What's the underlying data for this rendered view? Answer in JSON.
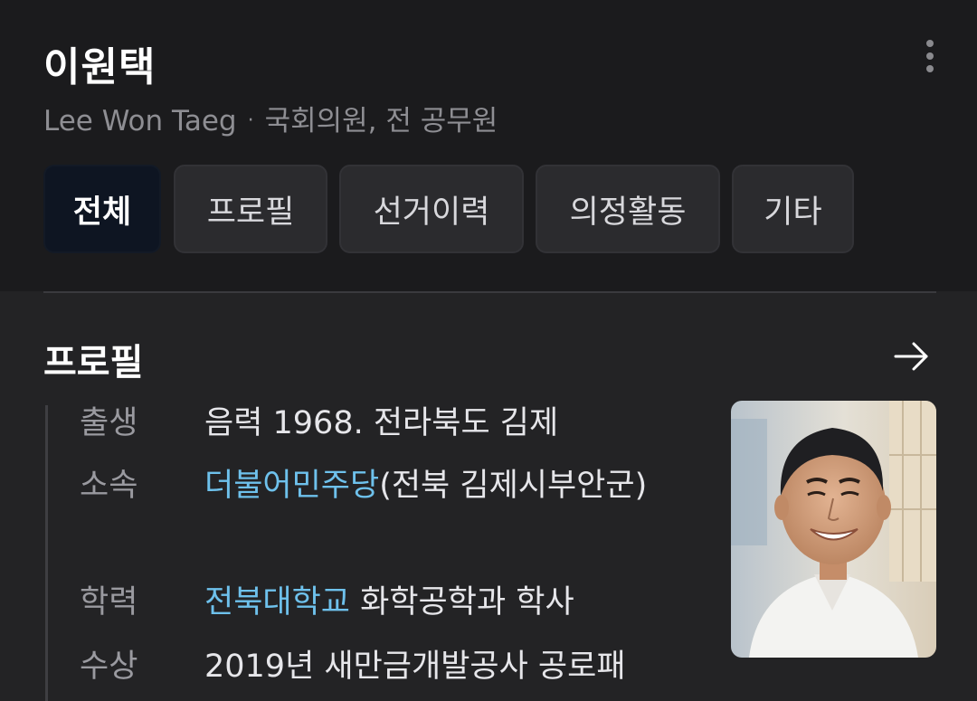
{
  "header": {
    "name": "이원택",
    "english_name": "Lee Won Taeg",
    "separator": "·",
    "occupation": "국회의원, 전 공무원"
  },
  "tabs": [
    {
      "label": "전체",
      "active": true
    },
    {
      "label": "프로필",
      "active": false
    },
    {
      "label": "선거이력",
      "active": false
    },
    {
      "label": "의정활동",
      "active": false
    },
    {
      "label": "기타",
      "active": false
    }
  ],
  "profile": {
    "title": "프로필",
    "rows": [
      {
        "label": "출생",
        "text": "음력 1968. 전라북도 김제"
      },
      {
        "label": "소속",
        "link": "더불어민주당",
        "text": "(전북 김제시부안군)"
      },
      {
        "label": "학력",
        "link": "전북대학교",
        "text": " 화학공학과 학사"
      },
      {
        "label": "수상",
        "text": "2019년 새만금개발공사 공로패"
      }
    ]
  },
  "colors": {
    "link": "#6ec1ec",
    "active_tab_bg": "#0e1522",
    "background": "#1b1b1d",
    "panel": "#232325"
  },
  "icons": {
    "more": "more-vertical-icon",
    "arrow": "arrow-right-icon"
  }
}
